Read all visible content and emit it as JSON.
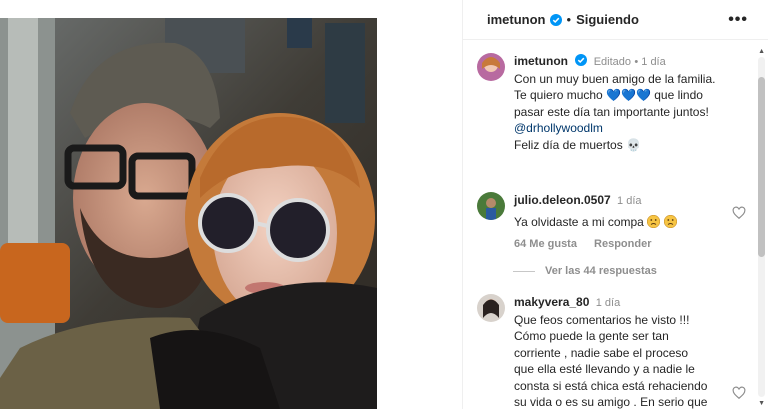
{
  "post": {
    "author": "imetunon",
    "follow_status": "Siguiendo",
    "more_icon": "more-icon",
    "verified_color": "#0095f6"
  },
  "caption": {
    "username": "imetunon",
    "edited": "Editado",
    "time": "1 día",
    "line1": "Con un muy buen amigo de la familia.",
    "line2a": "Te quiero mucho",
    "line2b": "que lindo",
    "line3": "pasar este día tan importante juntos!",
    "mention": "@drhollywoodlm",
    "line5": "Feliz día de muertos"
  },
  "comments": [
    {
      "username": "julio.deleon.0507",
      "time": "1 día",
      "text": "Ya olvidaste a mi compa",
      "likes": "64 Me gusta",
      "reply": "Responder",
      "view_replies": "Ver las 44 respuestas"
    },
    {
      "username": "makyvera_80",
      "time": "1 día",
      "lines": [
        "Que feos comentarios he visto !!!",
        "Cómo puede la gente ser tan",
        "corriente , nadie sabe el proceso",
        "que ella esté llevando y a nadie le",
        "consta si está chica está rehaciendo",
        "su vida o es su amigo . En serio que"
      ]
    }
  ]
}
